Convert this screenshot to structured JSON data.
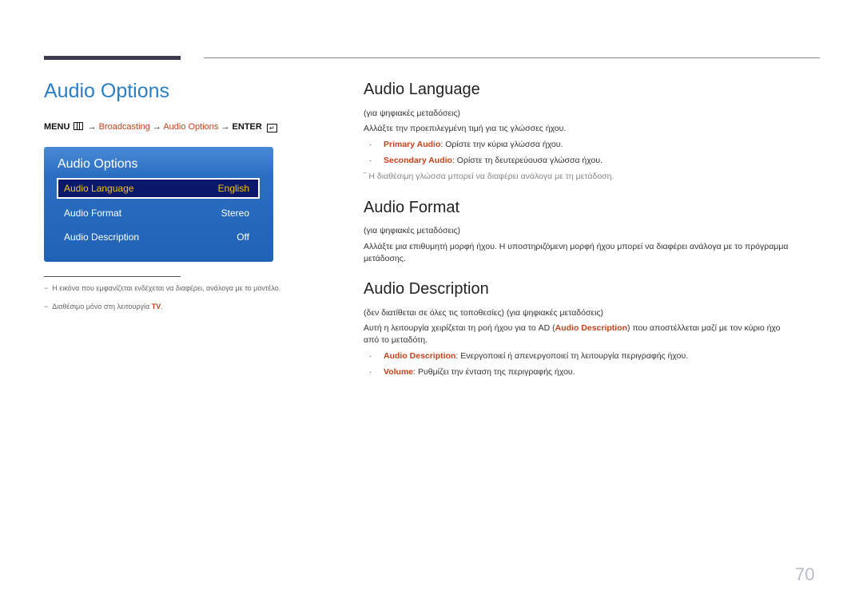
{
  "page": {
    "title": "Audio Options",
    "page_number": "70"
  },
  "menu_path": {
    "menu": "MENU",
    "arrow": "→",
    "broadcasting": "Broadcasting",
    "audio_options": "Audio Options",
    "enter": "ENTER"
  },
  "osd": {
    "title": "Audio Options",
    "items": [
      {
        "label": "Audio Language",
        "value": "English",
        "selected": true
      },
      {
        "label": "Audio Format",
        "value": "Stereo",
        "selected": false
      },
      {
        "label": "Audio Description",
        "value": "Off",
        "selected": false
      }
    ]
  },
  "footnotes": [
    {
      "dash": "−",
      "text": "Η εικόνα που εμφανίζεται ενδέχεται να διαφέρει, ανάλογα με το μοντέλο."
    },
    {
      "dash": "−",
      "text": "Διαθέσιμο μόνο στη λειτουργία ",
      "highlight": "TV",
      "suffix": "."
    }
  ],
  "sections": {
    "audio_language": {
      "heading": "Audio Language",
      "qualifier": "(για ψηφιακές μεταδόσεις)",
      "body": "Αλλάξτε την προεπιλεγμένη τιμή για τις γλώσσες ήχου.",
      "bullets": [
        {
          "term": "Primary Audio",
          "text": ": Ορίστε την κύρια γλώσσα ήχου."
        },
        {
          "term": "Secondary Audio",
          "text": ": Ορίστε τη δευτερεύουσα γλώσσα ήχου."
        }
      ],
      "note": "Η διαθέσιμη γλώσσα μπορεί να διαφέρει ανάλογα με τη μετάδοση."
    },
    "audio_format": {
      "heading": "Audio Format",
      "qualifier": "(για ψηφιακές μεταδόσεις)",
      "body_line1": "Αλλάξτε μια επιθυμητή μορφή ήχου. Η υποστηριζόμενη μορφή ήχου μπορεί να διαφέρει ανάλογα με το πρόγραμμα",
      "body_line2": "μετάδοσης."
    },
    "audio_description": {
      "heading": "Audio Description",
      "qualifier": "(δεν διατίθεται σε όλες τις τοποθεσίες) (για ψηφιακές μεταδόσεις)",
      "body_pre": "Αυτή η λειτουργία χειρίζεται τη ροή ήχου για το AD (",
      "body_term": "Audio Description",
      "body_post": ") που αποστέλλεται μαζί με τον κύριο ήχο",
      "body_line2": "από το μεταδότη.",
      "bullets": [
        {
          "term": "Audio Description",
          "text": ": Ενεργοποιεί ή απενεργοποιεί τη λειτουργία περιγραφής ήχου."
        },
        {
          "term": "Volume",
          "text": ": Ρυθμίζει την ένταση της περιγραφής ήχου."
        }
      ]
    }
  },
  "colors": {
    "title_blue": "#2a7fc4",
    "link_orange": "#c5421c",
    "osd_blue": "#2062b6",
    "osd_selected_bg": "#0b1869",
    "osd_selected_text": "#f5c518"
  }
}
